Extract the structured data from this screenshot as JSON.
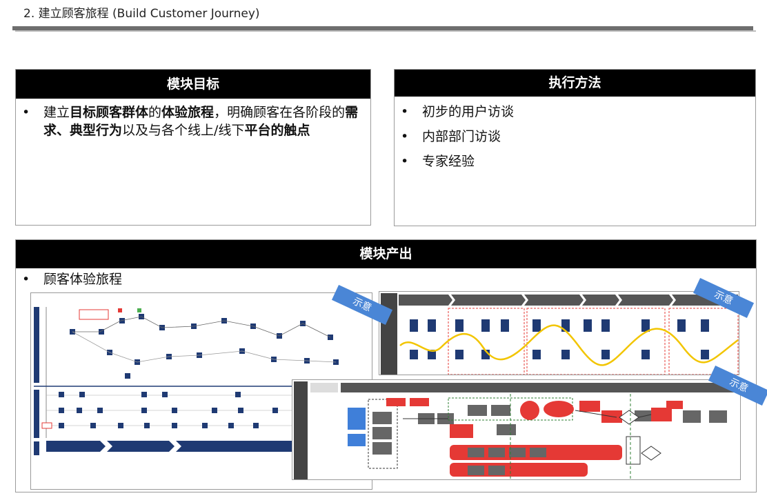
{
  "page": {
    "title": "2. 建立顾客旅程 (Build Customer Journey)"
  },
  "goal_box": {
    "heading": "模块目标",
    "bullet": [
      {
        "text": "建立",
        "bold": false
      },
      {
        "text": "目标顾客群体",
        "bold": true
      },
      {
        "text": "的",
        "bold": false
      },
      {
        "text": "体验旅程",
        "bold": true
      },
      {
        "text": "，明确顾客在各阶段的",
        "bold": false
      },
      {
        "text": "需求",
        "bold": true
      },
      {
        "text": "、",
        "bold": true
      },
      {
        "text": "典型行为",
        "bold": true
      },
      {
        "text": "以及与各个线上/线下",
        "bold": false
      },
      {
        "text": "平台的触点",
        "bold": true
      }
    ]
  },
  "method_box": {
    "heading": "执行方法",
    "items": [
      "初步的用户访谈",
      "内部部门访谈",
      "专家经验"
    ]
  },
  "output_box": {
    "heading": "模块产出",
    "items": [
      "顾客体验旅程"
    ],
    "sample_label": "示意"
  },
  "colors": {
    "header_bg": "#000000",
    "rule": "#6e6e6e",
    "badge": "#4a86d6",
    "journey_red": "#e53935",
    "journey_yellow": "#f2c500",
    "journey_navy": "#1f3a73"
  }
}
